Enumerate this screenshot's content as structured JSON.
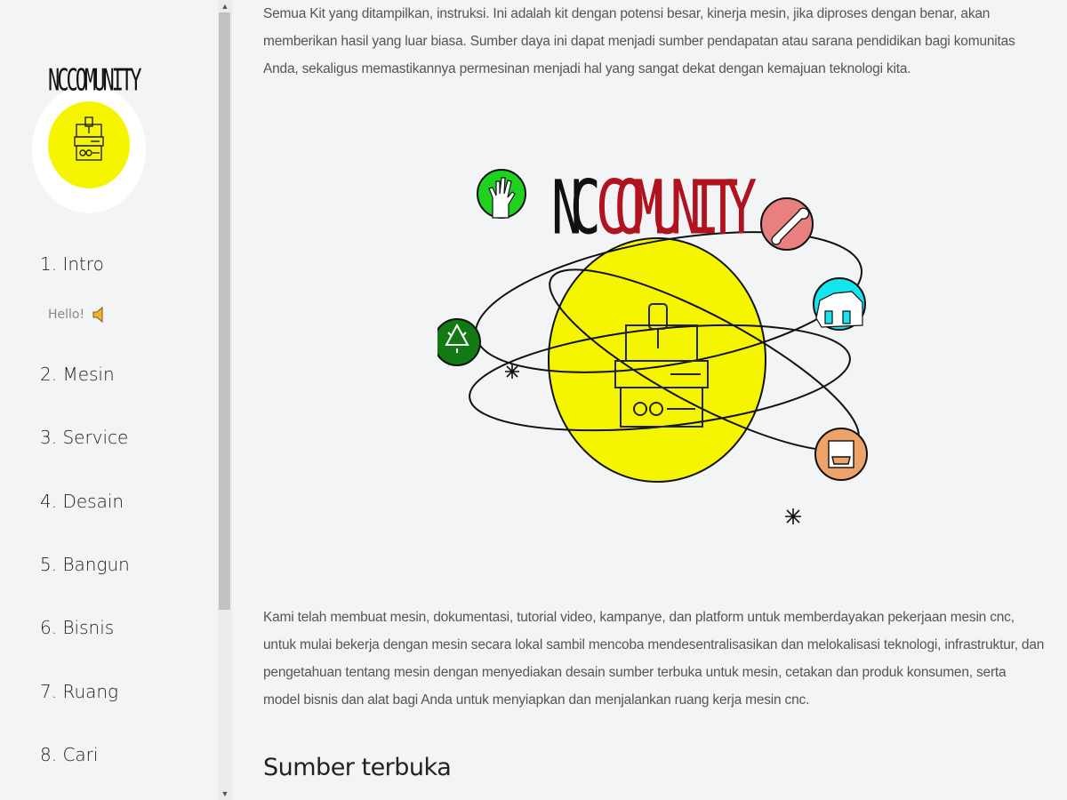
{
  "brand": {
    "logo_nc": "NC",
    "logo_text": "COMUNITY"
  },
  "sidebar": {
    "hello": "Hello!",
    "items": [
      {
        "label": "1. Intro"
      },
      {
        "label": "2. Mesin"
      },
      {
        "label": "3. Service"
      },
      {
        "label": "4. Desain"
      },
      {
        "label": "5. Bangun"
      },
      {
        "label": "6. Bisnis"
      },
      {
        "label": "7. Ruang"
      },
      {
        "label": "8. Cari"
      }
    ]
  },
  "main": {
    "paragraph_1": "Semua Kit yang ditampilkan, instruksi. Ini adalah kit dengan potensi besar, kinerja mesin, jika diproses dengan benar, akan memberikan hasil yang luar biasa. Sumber daya ini dapat menjadi sumber pendapatan atau sarana pendidikan bagi komunitas Anda, sekaligus memastikannya permesinan menjadi hal yang sangat dekat dengan kemajuan teknologi kita.",
    "paragraph_2": "Kami telah membuat mesin, dokumentasi, tutorial video, kampanye, dan platform untuk memberdayakan pekerjaan mesin cnc, untuk mulai bekerja dengan mesin secara lokal sambil mencoba mendesentralisasikan dan melokalisasi teknologi, infrastruktur, dan pengetahuan tentang mesin dengan menyediakan desain sumber terbuka untuk mesin, cetakan dan produk konsumen, serta model bisnis dan alat bagi Anda untuk menyiapkan dan menjalankan ruang kerja mesin cnc.",
    "section_heading": "Sumber terbuka"
  },
  "colors": {
    "logo_yellow": "#f5f500",
    "title_red": "#b0131e",
    "planet_green_light": "#1fd21f",
    "planet_green_dark": "#137a13",
    "planet_pink": "#e88080",
    "planet_cyan": "#15e5ee",
    "planet_orange": "#eea36a"
  },
  "icons": {
    "logo": "cnc-machine-icon",
    "speaker": "speaker-icon",
    "hand": "hand-icon",
    "wrench": "wrench-icon",
    "house": "house-icon",
    "recycle": "recycle-icon",
    "box": "box-icon"
  }
}
